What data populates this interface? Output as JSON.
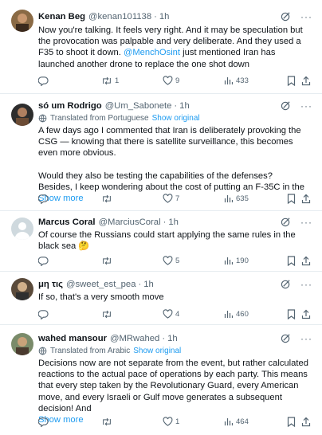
{
  "tweets": [
    {
      "name": "Kenan Beg",
      "handle": "@kenan101138",
      "time": "1h",
      "translated": false,
      "text_before": "Now you're talking. It feels very right. And it may be speculation but the provocation was palpable and very deliberate. And they used a F35 to shoot it down. ",
      "mention": "@MenchOsint",
      "text_after": " just mentioned Iran has launched another drone to replace the one shot down",
      "show_more": "",
      "replies": "",
      "retweets": "1",
      "likes": "9",
      "views": "433"
    },
    {
      "name": "só um Rodrigo",
      "handle": "@Um_Sabonete",
      "time": "1h",
      "translated": true,
      "translated_label": "Translated from Portuguese",
      "show_original": "Show original",
      "text_before": "A few days ago I commented that Iran is deliberately provoking the CSG — knowing that there is satellite surveillance, this becomes even more obvious.\n\nWould they also be testing the capabilities of the defenses?\nBesides, I keep wondering about the cost of putting an F-35C in the",
      "mention": "",
      "text_after": "",
      "show_more": "Show more",
      "replies": "",
      "retweets": "",
      "likes": "7",
      "views": "635"
    },
    {
      "name": "Marcus Coral",
      "handle": "@MarciusCoral",
      "time": "1h",
      "translated": false,
      "text_before": "Of course the Russians could start applying the same rules in the black sea 🤔",
      "mention": "",
      "text_after": "",
      "show_more": "",
      "replies": "",
      "retweets": "",
      "likes": "5",
      "views": "190"
    },
    {
      "name": "μη τις",
      "handle": "@sweet_est_pea",
      "time": "1h",
      "translated": false,
      "text_before": "If so, that's a very smooth move",
      "mention": "",
      "text_after": "",
      "show_more": "",
      "replies": "",
      "retweets": "",
      "likes": "4",
      "views": "460"
    },
    {
      "name": "wahed mansour",
      "handle": "@MRwahed",
      "time": "1h",
      "translated": true,
      "translated_label": "Translated from Arabic",
      "show_original": "Show original",
      "text_before": "Decisions now are not separate from the event, but rather calculated reactions to the actual pace of operations by each party. This means that every step taken by the Revolutionary Guard, every American move, and every Israeli or Gulf move generates a subsequent decision! And",
      "mention": "",
      "text_after": "",
      "show_more": "Show more",
      "replies": "",
      "retweets": "",
      "likes": "1",
      "views": "464"
    }
  ],
  "icons": {
    "grok": "grok-icon",
    "more": "more-icon",
    "reply": "reply-icon",
    "retweet": "retweet-icon",
    "like": "like-icon",
    "views": "views-icon",
    "bookmark": "bookmark-icon",
    "share": "share-icon",
    "translate": "globe-icon"
  },
  "colors": {
    "link": "#1d9bf0",
    "secondary": "#536471",
    "text": "#0f1419",
    "divider": "#e6ecf0"
  }
}
